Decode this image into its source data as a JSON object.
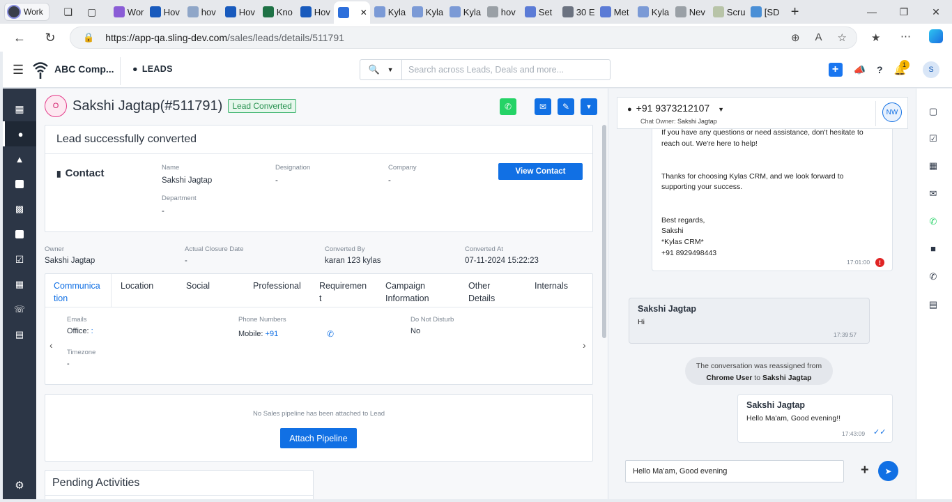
{
  "browser": {
    "profile_label": "Work",
    "tabs": [
      {
        "label": "Wor",
        "color": "#8a5cd6"
      },
      {
        "label": "Hov",
        "color": "#185abd"
      },
      {
        "label": "hov",
        "color": "#8fa6c8"
      },
      {
        "label": "Hov",
        "color": "#185abd"
      },
      {
        "label": "Kno",
        "color": "#1e7145"
      },
      {
        "label": "Hov",
        "color": "#185abd"
      },
      {
        "label": "",
        "color": "#2d6fdb"
      },
      {
        "label": "Kyla",
        "color": "#7b9ad6"
      },
      {
        "label": "Kyla",
        "color": "#7b9ad6"
      },
      {
        "label": "Kyla",
        "color": "#7b9ad6"
      },
      {
        "label": "hov",
        "color": "#9aa0a6"
      },
      {
        "label": "Set",
        "color": "#5b7bd6"
      },
      {
        "label": "30 E",
        "color": "#6b7280"
      },
      {
        "label": "Met",
        "color": "#5b7bd6"
      },
      {
        "label": "Kyla",
        "color": "#7b9ad6"
      },
      {
        "label": "Nev",
        "color": "#9aa0a6"
      },
      {
        "label": "Scru",
        "color": "#b8c4a8"
      },
      {
        "label": "[SD",
        "color": "#4a8fd6"
      }
    ],
    "url_host": "https://app-qa.sling-dev.com",
    "url_path": "/sales/leads/details/511791"
  },
  "header": {
    "company": "ABC Comp...",
    "module": "LEADS",
    "search_placeholder": "Search across Leads, Deals and more...",
    "notification_count": "1",
    "user_initial": "S"
  },
  "lead": {
    "status_initial": "O",
    "name": "Sakshi Jagtap(#511791)",
    "badge": "Lead Converted"
  },
  "conversion": {
    "title": "Lead successfully converted",
    "section": "Contact",
    "view_button": "View Contact",
    "fields": [
      {
        "label": "Name",
        "value": "Sakshi Jagtap"
      },
      {
        "label": "Designation",
        "value": "-"
      },
      {
        "label": "Company",
        "value": "-"
      },
      {
        "label": "Department",
        "value": "-"
      }
    ]
  },
  "summary": [
    {
      "label": "Owner",
      "value": "Sakshi Jagtap"
    },
    {
      "label": "Actual Closure Date",
      "value": "-"
    },
    {
      "label": "Converted By",
      "value": "karan 123 kylas"
    },
    {
      "label": "Converted At",
      "value": "07-11-2024 15:22:23"
    }
  ],
  "detail_tabs": {
    "tabs": [
      {
        "line1": "Communica",
        "line2": "tion"
      },
      {
        "line1": "Location",
        "line2": ""
      },
      {
        "line1": "Social",
        "line2": ""
      },
      {
        "line1": "Professional",
        "line2": ""
      },
      {
        "line1": "Requiremen",
        "line2": "t"
      },
      {
        "line1": "Campaign",
        "line2": "Information"
      },
      {
        "line1": "Other",
        "line2": "Details"
      },
      {
        "line1": "Internals",
        "line2": ""
      }
    ],
    "emails_label": "Emails",
    "office_label": "Office:",
    "office_value": ":",
    "phone_label": "Phone Numbers",
    "mobile_label": "Mobile:",
    "mobile_value": "+91",
    "dnd_label": "Do Not Disturb",
    "dnd_value": "No",
    "timezone_label": "Timezone",
    "timezone_value": "-"
  },
  "pipeline": {
    "note": "No Sales pipeline has been attached to Lead",
    "button": "Attach Pipeline"
  },
  "pending": {
    "title": "Pending Activities"
  },
  "chat": {
    "phone": "+91 9373212107",
    "owner_prefix": "Chat Owner:",
    "owner_name": "Sakshi Jagtap",
    "agent_initials": "NW",
    "outgoing_email": {
      "lines": [
        "If you have any questions or need assistance, don't hesitate to",
        "reach out. We're here to help!",
        "",
        "",
        "Thanks for choosing Kylas CRM, and we look forward to",
        "supporting your success.",
        "",
        "",
        "Best regards,",
        " Sakshi",
        "*Kylas CRM*",
        "+91 8929498443"
      ],
      "time": "17:01:00"
    },
    "incoming": {
      "sender": "Sakshi Jagtap",
      "text": "Hi",
      "time": "17:39:57"
    },
    "system": {
      "prefix": "The conversation was reassigned from",
      "from": "Chrome User",
      "to_word": "to",
      "to": "Sakshi Jagtap"
    },
    "outgoing": {
      "sender": "Sakshi Jagtap",
      "text": "Hello Ma'am, Good evening!!",
      "time": "17:43:09"
    },
    "input_value": "Hello Ma'am, Good evening"
  },
  "colors": {
    "primary": "#1170e4",
    "nav_bg": "#2c3646",
    "whatsapp": "#25d366",
    "badge_green": "#27914f",
    "error": "#e02424"
  }
}
